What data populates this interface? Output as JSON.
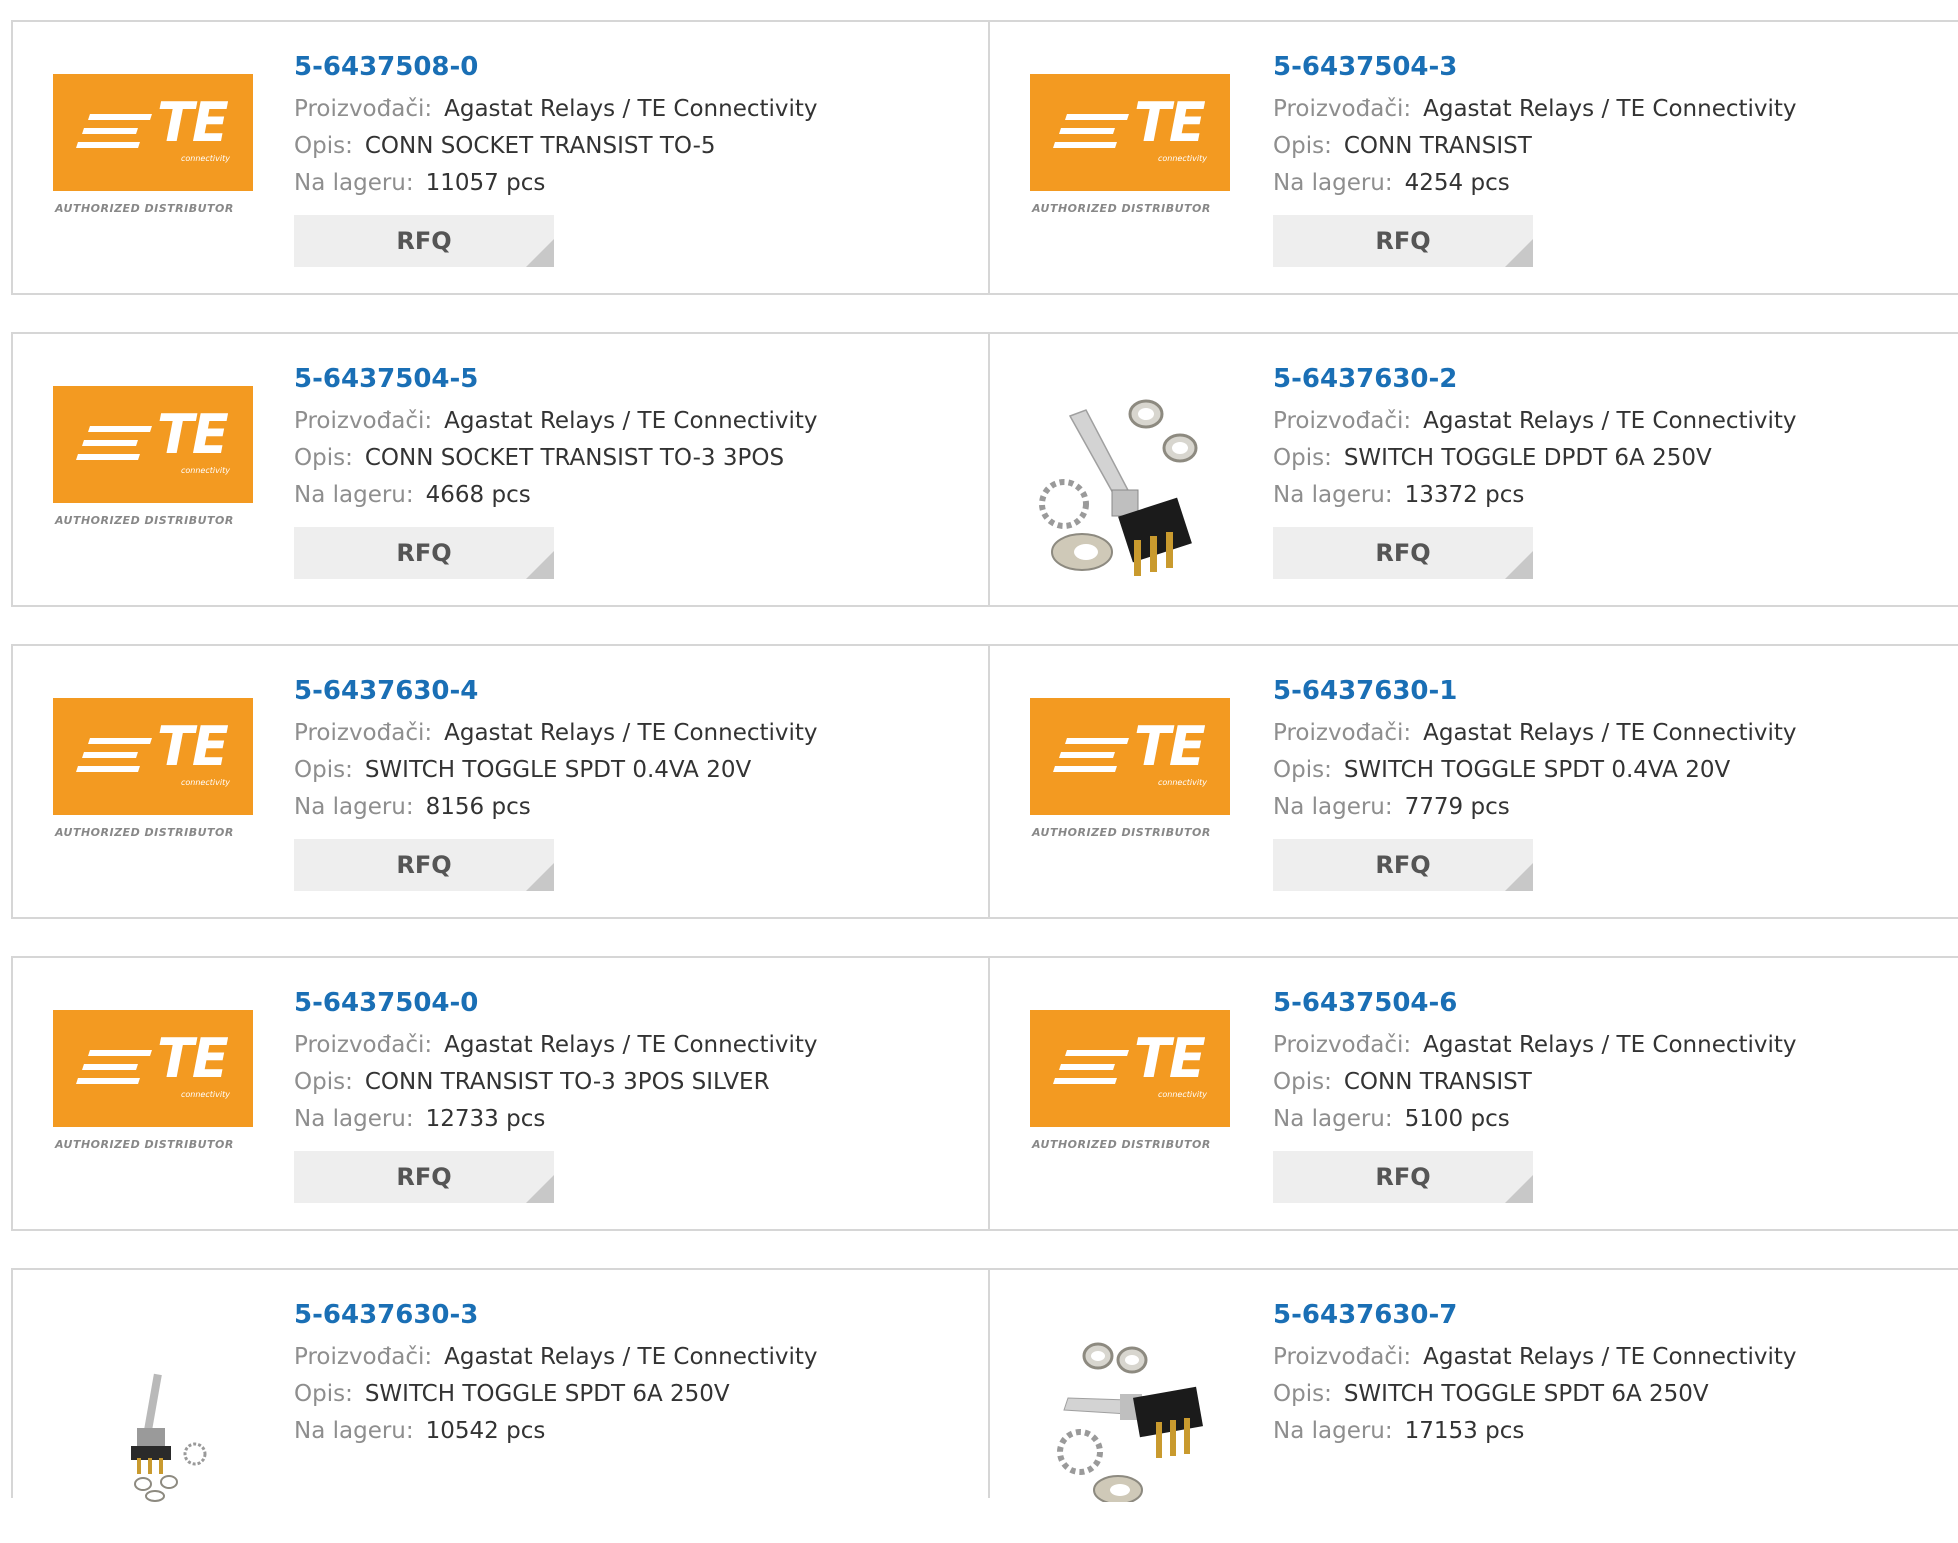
{
  "labels": {
    "manufacturer": "Proizvođači:",
    "description": "Opis:",
    "stock": "Na lageru:",
    "rfq": "RFQ"
  },
  "logo": {
    "text": "TE",
    "sub": "connectivity",
    "tagline": "AUTHORIZED DISTRIBUTOR"
  },
  "colors": {
    "brand_orange": "#f39a21",
    "link_blue": "#1a6fb5"
  },
  "products": [
    {
      "part": "5-6437508-0",
      "manufacturer": "Agastat Relays / TE Connectivity",
      "description": "CONN SOCKET TRANSIST TO-5",
      "stock": "11057 pcs",
      "image": "te-logo"
    },
    {
      "part": "5-6437504-3",
      "manufacturer": "Agastat Relays / TE Connectivity",
      "description": "CONN TRANSIST",
      "stock": "4254 pcs",
      "image": "te-logo"
    },
    {
      "part": "5-6437504-5",
      "manufacturer": "Agastat Relays / TE Connectivity",
      "description": "CONN SOCKET TRANSIST TO-3 3POS",
      "stock": "4668 pcs",
      "image": "te-logo"
    },
    {
      "part": "5-6437630-2",
      "manufacturer": "Agastat Relays / TE Connectivity",
      "description": "SWITCH TOGGLE DPDT 6A 250V",
      "stock": "13372 pcs",
      "image": "toggle-switch-photo"
    },
    {
      "part": "5-6437630-4",
      "manufacturer": "Agastat Relays / TE Connectivity",
      "description": "SWITCH TOGGLE SPDT 0.4VA 20V",
      "stock": "8156 pcs",
      "image": "te-logo"
    },
    {
      "part": "5-6437630-1",
      "manufacturer": "Agastat Relays / TE Connectivity",
      "description": "SWITCH TOGGLE SPDT 0.4VA 20V",
      "stock": "7779 pcs",
      "image": "te-logo"
    },
    {
      "part": "5-6437504-0",
      "manufacturer": "Agastat Relays / TE Connectivity",
      "description": "CONN TRANSIST TO-3 3POS SILVER",
      "stock": "12733 pcs",
      "image": "te-logo"
    },
    {
      "part": "5-6437504-6",
      "manufacturer": "Agastat Relays / TE Connectivity",
      "description": "CONN TRANSIST",
      "stock": "5100 pcs",
      "image": "te-logo"
    },
    {
      "part": "5-6437630-3",
      "manufacturer": "Agastat Relays / TE Connectivity",
      "description": "SWITCH TOGGLE SPDT 6A 250V",
      "stock": "10542 pcs",
      "image": "small-toggle-switch-photo"
    },
    {
      "part": "5-6437630-7",
      "manufacturer": "Agastat Relays / TE Connectivity",
      "description": "SWITCH TOGGLE SPDT 6A 250V",
      "stock": "17153 pcs",
      "image": "toggle-switch-photo"
    }
  ]
}
